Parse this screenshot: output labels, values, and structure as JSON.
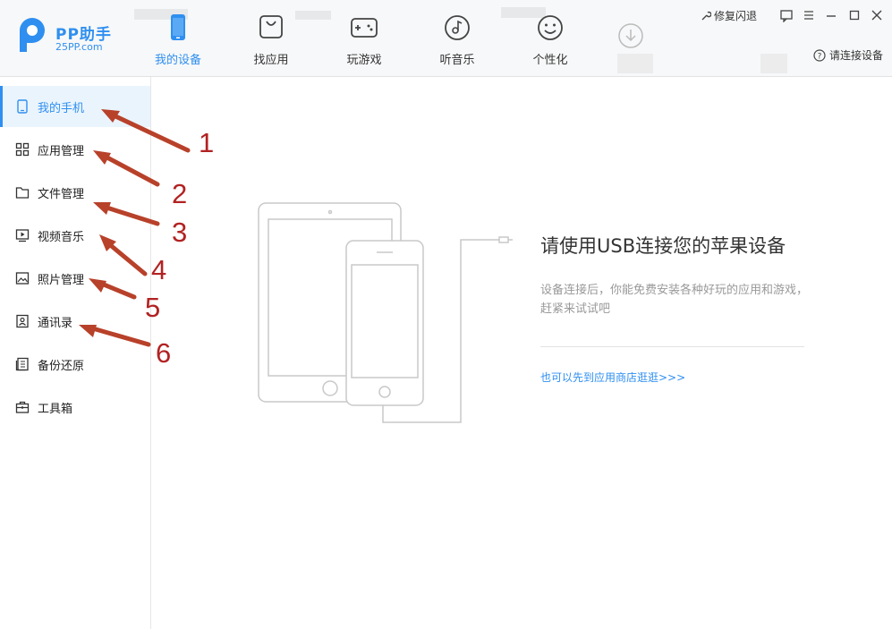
{
  "app": {
    "name": "PP助手",
    "domain": "25PP.com"
  },
  "nav": {
    "tabs": [
      {
        "label": "我的设备",
        "icon": "device-icon",
        "active": true
      },
      {
        "label": "找应用",
        "icon": "bag-icon"
      },
      {
        "label": "玩游戏",
        "icon": "gamepad-icon"
      },
      {
        "label": "听音乐",
        "icon": "music-disc-icon"
      },
      {
        "label": "个性化",
        "icon": "smiley-icon"
      }
    ],
    "download_icon": "download-icon"
  },
  "top_right": {
    "repair_label": "修复闪退",
    "connect_label": "请连接设备"
  },
  "sidebar": {
    "items": [
      {
        "label": "我的手机",
        "icon": "phone-icon",
        "active": true
      },
      {
        "label": "应用管理",
        "icon": "grid-icon"
      },
      {
        "label": "文件管理",
        "icon": "folder-icon"
      },
      {
        "label": "视频音乐",
        "icon": "video-icon"
      },
      {
        "label": "照片管理",
        "icon": "photo-icon"
      },
      {
        "label": "通讯录",
        "icon": "contacts-icon"
      },
      {
        "label": "备份还原",
        "icon": "backup-icon"
      },
      {
        "label": "工具箱",
        "icon": "toolbox-icon"
      }
    ]
  },
  "annotations": [
    "1",
    "2",
    "3",
    "4",
    "5",
    "6"
  ],
  "main": {
    "title": "请使用USB连接您的苹果设备",
    "description": "设备连接后，你能免费安装各种好玩的应用和游戏，赶紧来试试吧",
    "store_link": "也可以先到应用商店逛逛>>>"
  },
  "colors": {
    "accent": "#2f8ff0",
    "annotation": "#b22222"
  }
}
